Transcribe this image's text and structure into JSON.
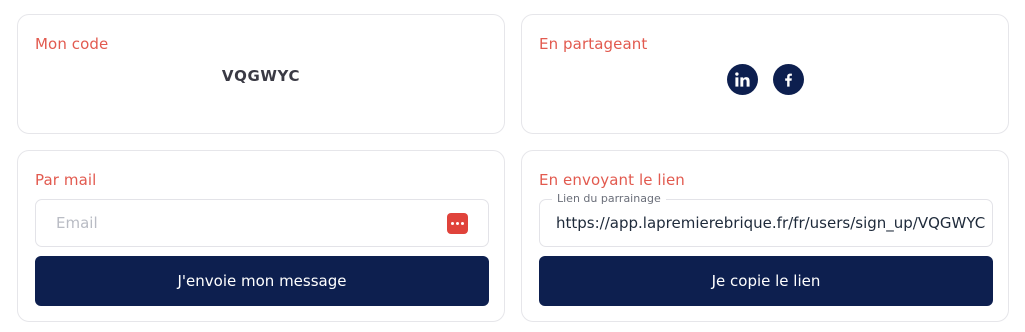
{
  "code_card": {
    "title": "Mon code",
    "code": "VQGWYC"
  },
  "share_card": {
    "title": "En partageant",
    "social": [
      {
        "icon": "linkedin-icon",
        "label": "in"
      },
      {
        "icon": "facebook-icon",
        "label": "f"
      }
    ]
  },
  "mail_card": {
    "title": "Par mail",
    "email_placeholder": "Email",
    "email_value": "",
    "submit_label": "J'envoie mon message"
  },
  "link_card": {
    "title": "En envoyant le lien",
    "field_label": "Lien du parrainage",
    "link_value": "https://app.lapremierebrique.fr/fr/users/sign_up/VQGWYC",
    "copy_label": "Je copie le lien"
  },
  "colors": {
    "accent": "#e25a4f",
    "primary": "#0d1f4f",
    "border": "#e6e6ea"
  }
}
